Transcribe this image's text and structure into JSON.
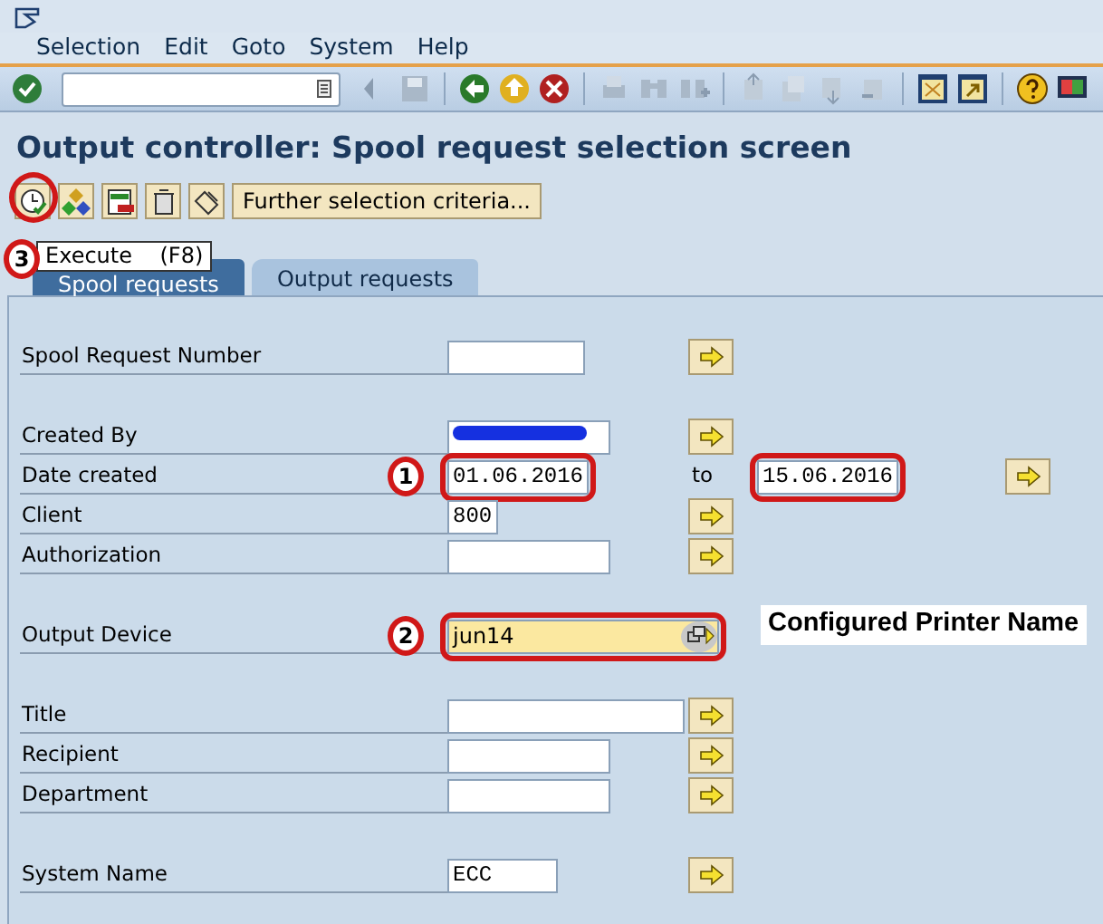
{
  "menu_bar": {
    "items": [
      "Selection",
      "Edit",
      "Goto",
      "System",
      "Help"
    ]
  },
  "title": "Output controller: Spool request selection screen",
  "app_toolbar": {
    "button": "Further selection criteria...",
    "execute_marker": "3"
  },
  "tooltip": "Execute    (F8)",
  "tabs": [
    {
      "label": "Spool requests",
      "selected": true
    },
    {
      "label": "Output requests",
      "selected": false
    }
  ],
  "field_groups": [
    [
      {
        "label": "Spool Request Number"
      }
    ],
    [
      {
        "label": "Created By",
        "redacted": true
      },
      {
        "label": "Date created",
        "value": "01.06.2016",
        "to_label": "to",
        "to_value": "15.06.2016",
        "marker": "1",
        "outlined": true
      },
      {
        "label": "Client",
        "value": "800"
      },
      {
        "label": "Authorization"
      }
    ],
    [
      {
        "label": "Output Device",
        "value": "jun14",
        "highlighted": true,
        "marker": "2",
        "outlined": true,
        "callout": "Configured Printer Name"
      }
    ],
    [
      {
        "label": "Title"
      },
      {
        "label": "Recipient"
      },
      {
        "label": "Department"
      }
    ],
    [
      {
        "label": "System Name",
        "value": "ECC"
      }
    ]
  ]
}
